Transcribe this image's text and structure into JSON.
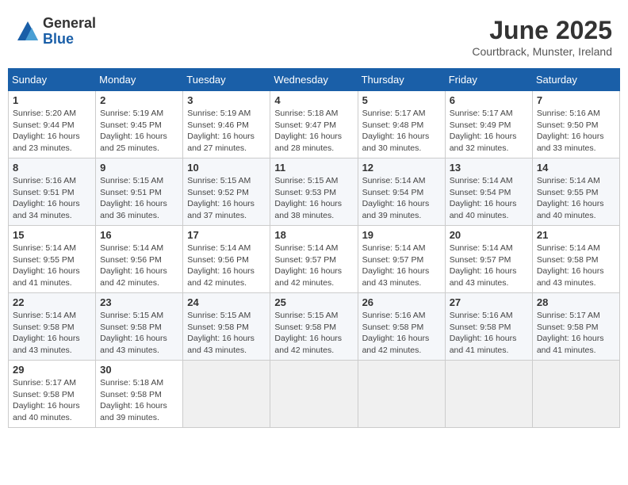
{
  "header": {
    "logo_line1": "General",
    "logo_line2": "Blue",
    "month_title": "June 2025",
    "location": "Courtbrack, Munster, Ireland"
  },
  "columns": [
    "Sunday",
    "Monday",
    "Tuesday",
    "Wednesday",
    "Thursday",
    "Friday",
    "Saturday"
  ],
  "weeks": [
    [
      {
        "day": "1",
        "info": "Sunrise: 5:20 AM\nSunset: 9:44 PM\nDaylight: 16 hours\nand 23 minutes."
      },
      {
        "day": "2",
        "info": "Sunrise: 5:19 AM\nSunset: 9:45 PM\nDaylight: 16 hours\nand 25 minutes."
      },
      {
        "day": "3",
        "info": "Sunrise: 5:19 AM\nSunset: 9:46 PM\nDaylight: 16 hours\nand 27 minutes."
      },
      {
        "day": "4",
        "info": "Sunrise: 5:18 AM\nSunset: 9:47 PM\nDaylight: 16 hours\nand 28 minutes."
      },
      {
        "day": "5",
        "info": "Sunrise: 5:17 AM\nSunset: 9:48 PM\nDaylight: 16 hours\nand 30 minutes."
      },
      {
        "day": "6",
        "info": "Sunrise: 5:17 AM\nSunset: 9:49 PM\nDaylight: 16 hours\nand 32 minutes."
      },
      {
        "day": "7",
        "info": "Sunrise: 5:16 AM\nSunset: 9:50 PM\nDaylight: 16 hours\nand 33 minutes."
      }
    ],
    [
      {
        "day": "8",
        "info": "Sunrise: 5:16 AM\nSunset: 9:51 PM\nDaylight: 16 hours\nand 34 minutes."
      },
      {
        "day": "9",
        "info": "Sunrise: 5:15 AM\nSunset: 9:51 PM\nDaylight: 16 hours\nand 36 minutes."
      },
      {
        "day": "10",
        "info": "Sunrise: 5:15 AM\nSunset: 9:52 PM\nDaylight: 16 hours\nand 37 minutes."
      },
      {
        "day": "11",
        "info": "Sunrise: 5:15 AM\nSunset: 9:53 PM\nDaylight: 16 hours\nand 38 minutes."
      },
      {
        "day": "12",
        "info": "Sunrise: 5:14 AM\nSunset: 9:54 PM\nDaylight: 16 hours\nand 39 minutes."
      },
      {
        "day": "13",
        "info": "Sunrise: 5:14 AM\nSunset: 9:54 PM\nDaylight: 16 hours\nand 40 minutes."
      },
      {
        "day": "14",
        "info": "Sunrise: 5:14 AM\nSunset: 9:55 PM\nDaylight: 16 hours\nand 40 minutes."
      }
    ],
    [
      {
        "day": "15",
        "info": "Sunrise: 5:14 AM\nSunset: 9:55 PM\nDaylight: 16 hours\nand 41 minutes."
      },
      {
        "day": "16",
        "info": "Sunrise: 5:14 AM\nSunset: 9:56 PM\nDaylight: 16 hours\nand 42 minutes."
      },
      {
        "day": "17",
        "info": "Sunrise: 5:14 AM\nSunset: 9:56 PM\nDaylight: 16 hours\nand 42 minutes."
      },
      {
        "day": "18",
        "info": "Sunrise: 5:14 AM\nSunset: 9:57 PM\nDaylight: 16 hours\nand 42 minutes."
      },
      {
        "day": "19",
        "info": "Sunrise: 5:14 AM\nSunset: 9:57 PM\nDaylight: 16 hours\nand 43 minutes."
      },
      {
        "day": "20",
        "info": "Sunrise: 5:14 AM\nSunset: 9:57 PM\nDaylight: 16 hours\nand 43 minutes."
      },
      {
        "day": "21",
        "info": "Sunrise: 5:14 AM\nSunset: 9:58 PM\nDaylight: 16 hours\nand 43 minutes."
      }
    ],
    [
      {
        "day": "22",
        "info": "Sunrise: 5:14 AM\nSunset: 9:58 PM\nDaylight: 16 hours\nand 43 minutes."
      },
      {
        "day": "23",
        "info": "Sunrise: 5:15 AM\nSunset: 9:58 PM\nDaylight: 16 hours\nand 43 minutes."
      },
      {
        "day": "24",
        "info": "Sunrise: 5:15 AM\nSunset: 9:58 PM\nDaylight: 16 hours\nand 43 minutes."
      },
      {
        "day": "25",
        "info": "Sunrise: 5:15 AM\nSunset: 9:58 PM\nDaylight: 16 hours\nand 42 minutes."
      },
      {
        "day": "26",
        "info": "Sunrise: 5:16 AM\nSunset: 9:58 PM\nDaylight: 16 hours\nand 42 minutes."
      },
      {
        "day": "27",
        "info": "Sunrise: 5:16 AM\nSunset: 9:58 PM\nDaylight: 16 hours\nand 41 minutes."
      },
      {
        "day": "28",
        "info": "Sunrise: 5:17 AM\nSunset: 9:58 PM\nDaylight: 16 hours\nand 41 minutes."
      }
    ],
    [
      {
        "day": "29",
        "info": "Sunrise: 5:17 AM\nSunset: 9:58 PM\nDaylight: 16 hours\nand 40 minutes."
      },
      {
        "day": "30",
        "info": "Sunrise: 5:18 AM\nSunset: 9:58 PM\nDaylight: 16 hours\nand 39 minutes."
      },
      {
        "day": "",
        "info": ""
      },
      {
        "day": "",
        "info": ""
      },
      {
        "day": "",
        "info": ""
      },
      {
        "day": "",
        "info": ""
      },
      {
        "day": "",
        "info": ""
      }
    ]
  ]
}
